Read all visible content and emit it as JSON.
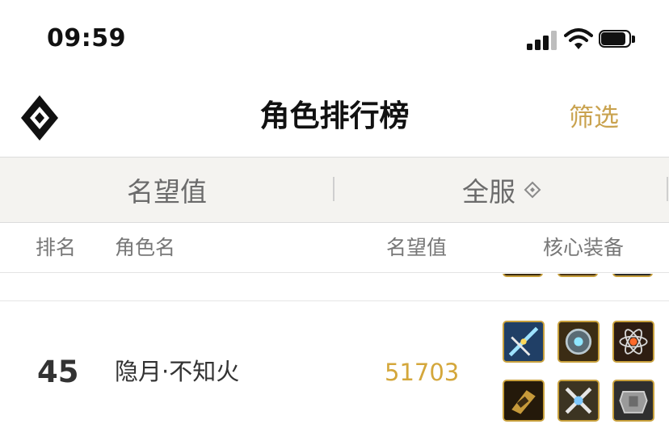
{
  "status_bar": {
    "time": "09:59"
  },
  "nav": {
    "title": "角色排行榜",
    "filter_label": "筛选"
  },
  "filter_tabs": {
    "metric": "名望值",
    "server": "全服"
  },
  "table": {
    "headers": {
      "rank": "排名",
      "name": "角色名",
      "score": "名望值",
      "equipment": "核心装备"
    },
    "rows": [
      {
        "rank": "45",
        "name": "隐月·不知火",
        "score": "51703"
      }
    ]
  },
  "colors": {
    "accent_gold": "#c9a24e",
    "score_gold": "#d4a73b",
    "filter_bg": "#f4f3f0"
  }
}
